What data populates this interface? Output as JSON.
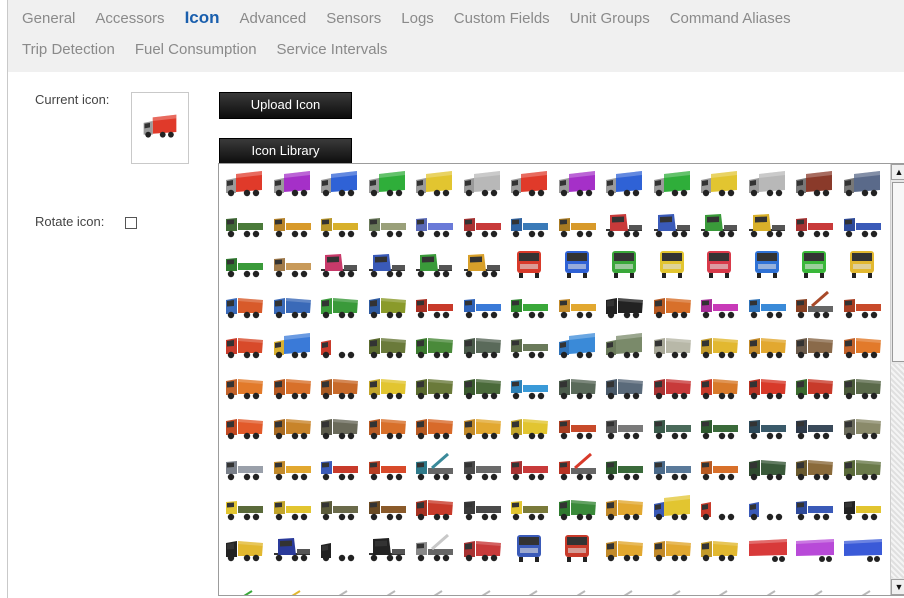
{
  "tabs": {
    "row1": [
      "General",
      "Accessors",
      "Icon",
      "Advanced",
      "Sensors",
      "Logs",
      "Custom Fields",
      "Unit Groups",
      "Command Aliases"
    ],
    "row2": [
      "Trip Detection",
      "Fuel Consumption",
      "Service Intervals"
    ],
    "active": "Icon"
  },
  "form": {
    "current_icon_label": "Current icon:",
    "rotate_icon_label": "Rotate icon:",
    "rotate_checked": false,
    "upload_button": "Upload Icon",
    "library_button": "Icon Library"
  },
  "current_icon": {
    "kind": "box-truck",
    "cab": "#9a9a9a",
    "body": "#e03a2a"
  },
  "icon_library": {
    "rows": [
      [
        {
          "kind": "box-truck",
          "body": "#e03a2a",
          "cab": "#9a9a9a"
        },
        {
          "kind": "box-truck",
          "body": "#a530c8",
          "cab": "#9a9a9a"
        },
        {
          "kind": "box-truck",
          "body": "#2f62d6",
          "cab": "#9a9a9a"
        },
        {
          "kind": "box-truck",
          "body": "#2fae3a",
          "cab": "#9a9a9a"
        },
        {
          "kind": "box-truck",
          "body": "#e2c530",
          "cab": "#9a9a9a"
        },
        {
          "kind": "box-truck",
          "body": "#b8b8b8",
          "cab": "#9a9a9a"
        },
        {
          "kind": "box-truck",
          "body": "#e03a2a",
          "cab": "#9a9a9a"
        },
        {
          "kind": "box-truck",
          "body": "#a530c8",
          "cab": "#9a9a9a"
        },
        {
          "kind": "box-truck",
          "body": "#2f62d6",
          "cab": "#9a9a9a"
        },
        {
          "kind": "box-truck",
          "body": "#2fae3a",
          "cab": "#9a9a9a"
        },
        {
          "kind": "box-truck",
          "body": "#e2c530",
          "cab": "#9a9a9a"
        },
        {
          "kind": "box-truck",
          "body": "#b8b8b8",
          "cab": "#9a9a9a"
        },
        {
          "kind": "box-truck",
          "body": "#8a3a2a",
          "cab": "#777777"
        },
        {
          "kind": "box-truck",
          "body": "#5a6a8a",
          "cab": "#777777"
        }
      ],
      [
        {
          "kind": "flatbed",
          "body": "#4a7a3a",
          "cab": "#3f6a35"
        },
        {
          "kind": "flatbed",
          "body": "#d89a2a",
          "cab": "#b8842a"
        },
        {
          "kind": "flatbed",
          "body": "#d8b02a",
          "cab": "#b8962a"
        },
        {
          "kind": "flatbed",
          "body": "#9aa07a",
          "cab": "#6a7a5a"
        },
        {
          "kind": "flatbed",
          "body": "#6a7ad8",
          "cab": "#5a6ab8"
        },
        {
          "kind": "flatbed",
          "body": "#c83a3a",
          "cab": "#a83232"
        },
        {
          "kind": "flatbed",
          "body": "#3a7ab8",
          "cab": "#2e62a0"
        },
        {
          "kind": "flatbed",
          "body": "#d89a2a",
          "cab": "#a87a22"
        },
        {
          "kind": "semi",
          "body": "#c83a3a",
          "cab": "#c83a3a"
        },
        {
          "kind": "semi",
          "body": "#3a5ab8",
          "cab": "#3a5ab8"
        },
        {
          "kind": "semi",
          "body": "#3a9a3a",
          "cab": "#3a9a3a"
        },
        {
          "kind": "semi",
          "body": "#d8b02a",
          "cab": "#d8b02a"
        },
        {
          "kind": "flatbed",
          "body": "#c83a3a",
          "cab": "#a83232"
        },
        {
          "kind": "flatbed",
          "body": "#3a5ab8",
          "cab": "#2e4a9a"
        }
      ],
      [
        {
          "kind": "flatbed",
          "body": "#3a9a3a",
          "cab": "#2e7a2e"
        },
        {
          "kind": "flatbed",
          "body": "#c89a5a",
          "cab": "#a07a4a"
        },
        {
          "kind": "semi",
          "body": "#c83a6a",
          "cab": "#c83a6a"
        },
        {
          "kind": "semi",
          "body": "#3a5ab8",
          "cab": "#3a5ab8"
        },
        {
          "kind": "semi",
          "body": "#3a9a3a",
          "cab": "#3a9a3a"
        },
        {
          "kind": "semi",
          "body": "#d8a02a",
          "cab": "#d8a02a"
        },
        {
          "kind": "front",
          "body": "#d83a2a",
          "cab": "#d83a2a"
        },
        {
          "kind": "front",
          "body": "#2f62d6",
          "cab": "#2f62d6"
        },
        {
          "kind": "front",
          "body": "#3aa83a",
          "cab": "#3aa83a"
        },
        {
          "kind": "front",
          "body": "#e2c530",
          "cab": "#e2c530"
        },
        {
          "kind": "front",
          "body": "#d83a4a",
          "cab": "#d83a4a"
        },
        {
          "kind": "front",
          "body": "#2f72d6",
          "cab": "#2f72d6"
        },
        {
          "kind": "front",
          "body": "#3ab83a",
          "cab": "#3ab83a"
        },
        {
          "kind": "front",
          "body": "#e2b830",
          "cab": "#e2b830"
        }
      ],
      [
        {
          "kind": "dump",
          "body": "#d85a2a",
          "cab": "#3a6ab8"
        },
        {
          "kind": "dump",
          "body": "#3a6ab8",
          "cab": "#3a6ab8"
        },
        {
          "kind": "dump",
          "body": "#3a9a3a",
          "cab": "#3a9a3a"
        },
        {
          "kind": "dump",
          "body": "#8a9a2a",
          "cab": "#2e5aa0"
        },
        {
          "kind": "flatbed",
          "body": "#c83a2a",
          "cab": "#a82e22"
        },
        {
          "kind": "flatbed",
          "body": "#3a7ad8",
          "cab": "#2e62b8"
        },
        {
          "kind": "flatbed",
          "body": "#3aa83a",
          "cab": "#2e882e"
        },
        {
          "kind": "flatbed",
          "body": "#e2a830",
          "cab": "#c28a2a"
        },
        {
          "kind": "dump",
          "body": "#222222",
          "cab": "#222222"
        },
        {
          "kind": "dump",
          "body": "#d8702a",
          "cab": "#b85a22"
        },
        {
          "kind": "flatbed",
          "body": "#c83ab8",
          "cab": "#a82e9a"
        },
        {
          "kind": "flatbed",
          "body": "#3a8ad8",
          "cab": "#2e72b8"
        },
        {
          "kind": "crane",
          "body": "#a84a2a",
          "cab": "#884022"
        },
        {
          "kind": "flatbed",
          "body": "#c84a2a",
          "cab": "#a83e22"
        }
      ],
      [
        {
          "kind": "dump",
          "body": "#d84a2a",
          "cab": "#c83a2a"
        },
        {
          "kind": "box-truck",
          "body": "#3a7ad8",
          "cab": "#d8b030"
        },
        {
          "kind": "box-truck",
          "body": "#ffffff",
          "cab": "#c83a2a"
        },
        {
          "kind": "dump",
          "body": "#6a7a3a",
          "cab": "#5a6a2e"
        },
        {
          "kind": "dump",
          "body": "#4a8a3a",
          "cab": "#3a7a2e"
        },
        {
          "kind": "dump",
          "body": "#5a6a5a",
          "cab": "#4a5a4a"
        },
        {
          "kind": "flatbed",
          "body": "#6a7a5a",
          "cab": "#5a6a4a"
        },
        {
          "kind": "box-truck",
          "body": "#3a8ad8",
          "cab": "#2e72b8"
        },
        {
          "kind": "box-truck",
          "body": "#7a8a6a",
          "cab": "#6a7a5a"
        },
        {
          "kind": "dump",
          "body": "#b8b8a8",
          "cab": "#a8a898"
        },
        {
          "kind": "dump",
          "body": "#e2b830",
          "cab": "#c29a2a"
        },
        {
          "kind": "dump",
          "body": "#e2a830",
          "cab": "#c28a2a"
        },
        {
          "kind": "dump",
          "body": "#8a6a4a",
          "cab": "#6a5a4a"
        },
        {
          "kind": "dump",
          "body": "#e27a2a",
          "cab": "#c2622a"
        }
      ],
      [
        {
          "kind": "dump",
          "body": "#e27a2a",
          "cab": "#c2622a"
        },
        {
          "kind": "dump",
          "body": "#d8702a",
          "cab": "#b85a22"
        },
        {
          "kind": "dump",
          "body": "#c86a2a",
          "cab": "#a85a22"
        },
        {
          "kind": "dump",
          "body": "#e2c530",
          "cab": "#c2a52a"
        },
        {
          "kind": "dump",
          "body": "#6a7a3a",
          "cab": "#5a6a2e"
        },
        {
          "kind": "dump",
          "body": "#4a6a3a",
          "cab": "#3a5a2e"
        },
        {
          "kind": "flatbed",
          "body": "#3a9ad8",
          "cab": "#2e82b8"
        },
        {
          "kind": "dump",
          "body": "#5a6a5a",
          "cab": "#4a5a4a"
        },
        {
          "kind": "dump",
          "body": "#5a6a7a",
          "cab": "#4a5a6a"
        },
        {
          "kind": "dump",
          "body": "#c83a3a",
          "cab": "#a83232"
        },
        {
          "kind": "dump",
          "body": "#d87a2a",
          "cab": "#c83a2a"
        },
        {
          "kind": "dump",
          "body": "#d83a2a",
          "cab": "#b83222"
        },
        {
          "kind": "dump",
          "body": "#c83a2a",
          "cab": "#3a6a2e"
        },
        {
          "kind": "dump",
          "body": "#5a6a4a",
          "cab": "#4a5a3a"
        }
      ],
      [
        {
          "kind": "dump",
          "body": "#e25a2a",
          "cab": "#c24a22"
        },
        {
          "kind": "dump",
          "body": "#c8842a",
          "cab": "#a86a22"
        },
        {
          "kind": "dump",
          "body": "#6a6a5a",
          "cab": "#5a5a4a"
        },
        {
          "kind": "dump",
          "body": "#d8702a",
          "cab": "#b85a22"
        },
        {
          "kind": "dump",
          "body": "#d86a2a",
          "cab": "#b85a22"
        },
        {
          "kind": "dump",
          "body": "#e2a830",
          "cab": "#c28a2a"
        },
        {
          "kind": "dump",
          "body": "#e2c530",
          "cab": "#c2a52a"
        },
        {
          "kind": "flatbed",
          "body": "#c84a2a",
          "cab": "#a83e22"
        },
        {
          "kind": "flatbed",
          "body": "#7a7a7a",
          "cab": "#5a5a5a"
        },
        {
          "kind": "flatbed",
          "body": "#4a6a5a",
          "cab": "#3a5a4a"
        },
        {
          "kind": "flatbed",
          "body": "#3a6a3a",
          "cab": "#2e5a2e"
        },
        {
          "kind": "flatbed",
          "body": "#3a5a6a",
          "cab": "#2e4a5a"
        },
        {
          "kind": "flatbed",
          "body": "#3a4a5a",
          "cab": "#2e3a4a"
        },
        {
          "kind": "dump",
          "body": "#8a8a6a",
          "cab": "#6a6a5a"
        }
      ],
      [
        {
          "kind": "flatbed",
          "body": "#9aa0aa",
          "cab": "#7a808a"
        },
        {
          "kind": "flatbed",
          "body": "#e2a830",
          "cab": "#c28a2a"
        },
        {
          "kind": "flatbed",
          "body": "#c83a2a",
          "cab": "#3a5ab8"
        },
        {
          "kind": "flatbed",
          "body": "#d84a2a",
          "cab": "#b83e22"
        },
        {
          "kind": "crane",
          "body": "#3a8a9a",
          "cab": "#2e7a8a"
        },
        {
          "kind": "flatbed",
          "body": "#6a6a6a",
          "cab": "#4a4a4a"
        },
        {
          "kind": "flatbed",
          "body": "#c83a3a",
          "cab": "#a83232"
        },
        {
          "kind": "crane",
          "body": "#d83a2a",
          "cab": "#b83222"
        },
        {
          "kind": "flatbed",
          "body": "#3a6a3a",
          "cab": "#2e5a2e"
        },
        {
          "kind": "flatbed",
          "body": "#5a7a9a",
          "cab": "#4a6a8a"
        },
        {
          "kind": "flatbed",
          "body": "#d8702a",
          "cab": "#b85a22"
        },
        {
          "kind": "dump",
          "body": "#3a5a3a",
          "cab": "#2e4a2e"
        },
        {
          "kind": "dump",
          "body": "#8a6a3a",
          "cab": "#6a5a2e"
        },
        {
          "kind": "dump",
          "body": "#6a7a4a",
          "cab": "#5a6a3a"
        }
      ],
      [
        {
          "kind": "flatbed",
          "body": "#5a6a3a",
          "cab": "#e2c530"
        },
        {
          "kind": "flatbed",
          "body": "#e2c530",
          "cab": "#c2a52a"
        },
        {
          "kind": "flatbed",
          "body": "#6a6a4a",
          "cab": "#5a5a3a"
        },
        {
          "kind": "flatbed",
          "body": "#8a5a2a",
          "cab": "#6a4a22"
        },
        {
          "kind": "dump",
          "body": "#c83a2a",
          "cab": "#a83222"
        },
        {
          "kind": "flatbed",
          "body": "#4a4a4a",
          "cab": "#3a3a3a"
        },
        {
          "kind": "flatbed",
          "body": "#7a7a3a",
          "cab": "#e2c530"
        },
        {
          "kind": "dump",
          "body": "#3a8a3a",
          "cab": "#2e7a2e"
        },
        {
          "kind": "dump",
          "body": "#e2a830",
          "cab": "#c28a2a"
        },
        {
          "kind": "box-truck",
          "body": "#e2c530",
          "cab": "#3a5ab8"
        },
        {
          "kind": "box-truck",
          "body": "#ffffff",
          "cab": "#c83a2a"
        },
        {
          "kind": "box-truck",
          "body": "#ffffff",
          "cab": "#3a5ab8"
        },
        {
          "kind": "flatbed",
          "body": "#3a5ab8",
          "cab": "#2e4a9a"
        },
        {
          "kind": "flatbed",
          "body": "#e2c530",
          "cab": "#222222"
        }
      ],
      [
        {
          "kind": "dump",
          "body": "#e2b830",
          "cab": "#222222"
        },
        {
          "kind": "semi",
          "body": "#2a3a9a",
          "cab": "#2a3a9a"
        },
        {
          "kind": "box-truck",
          "body": "#ffffff",
          "cab": "#222222"
        },
        {
          "kind": "semi",
          "body": "#ffffff",
          "cab": "#222222"
        },
        {
          "kind": "crane",
          "body": "#c8c8c8",
          "cab": "#888888"
        },
        {
          "kind": "dump",
          "body": "#c83a3a",
          "cab": "#a83232"
        },
        {
          "kind": "front",
          "body": "#3a5ab8",
          "cab": "#3a5ab8"
        },
        {
          "kind": "front",
          "body": "#c83a2a",
          "cab": "#c83a2a"
        },
        {
          "kind": "dump",
          "body": "#e2a830",
          "cab": "#c28a2a"
        },
        {
          "kind": "dump",
          "body": "#e2a830",
          "cab": "#c28a2a"
        },
        {
          "kind": "dump",
          "body": "#e2b830",
          "cab": "#c29a2a"
        },
        {
          "kind": "trailer",
          "body": "#d83a3a",
          "cab": "#d83a3a"
        },
        {
          "kind": "trailer",
          "body": "#b84ad8",
          "cab": "#b84ad8"
        },
        {
          "kind": "trailer",
          "body": "#3a5ad8",
          "cab": "#3a5ad8"
        }
      ],
      [
        {
          "kind": "partial",
          "body": "#3aa83a",
          "cab": "#3aa83a"
        },
        {
          "kind": "partial",
          "body": "#e2b830",
          "cab": "#e2b830"
        },
        {
          "kind": "partial",
          "body": "#b8b8b8",
          "cab": "#b8b8b8"
        },
        {
          "kind": "partial",
          "body": "#b8b8b8",
          "cab": "#b8b8b8"
        },
        {
          "kind": "partial",
          "body": "#b8b8b8",
          "cab": "#b8b8b8"
        },
        {
          "kind": "partial",
          "body": "#b8b8b8",
          "cab": "#b8b8b8"
        },
        {
          "kind": "partial",
          "body": "#b8b8b8",
          "cab": "#b8b8b8"
        },
        {
          "kind": "partial",
          "body": "#b8b8b8",
          "cab": "#b8b8b8"
        },
        {
          "kind": "partial",
          "body": "#b8b8b8",
          "cab": "#b8b8b8"
        },
        {
          "kind": "partial",
          "body": "#b8b8b8",
          "cab": "#b8b8b8"
        },
        {
          "kind": "partial",
          "body": "#b8b8b8",
          "cab": "#b8b8b8"
        },
        {
          "kind": "partial",
          "body": "#b8b8b8",
          "cab": "#b8b8b8"
        },
        {
          "kind": "partial",
          "body": "#b8b8b8",
          "cab": "#b8b8b8"
        },
        {
          "kind": "partial",
          "body": "#b8b8b8",
          "cab": "#b8b8b8"
        }
      ]
    ],
    "scrollbar": {
      "up_icon": "arrow-up-icon",
      "down_icon": "arrow-down-icon",
      "scroll_position": 0.0
    }
  },
  "colors": {
    "active_tab": "#1a5fad",
    "inactive_tab": "#8a8a8a",
    "tab_bar_bg": "#f0f0f0",
    "button_bg": "#111111"
  }
}
